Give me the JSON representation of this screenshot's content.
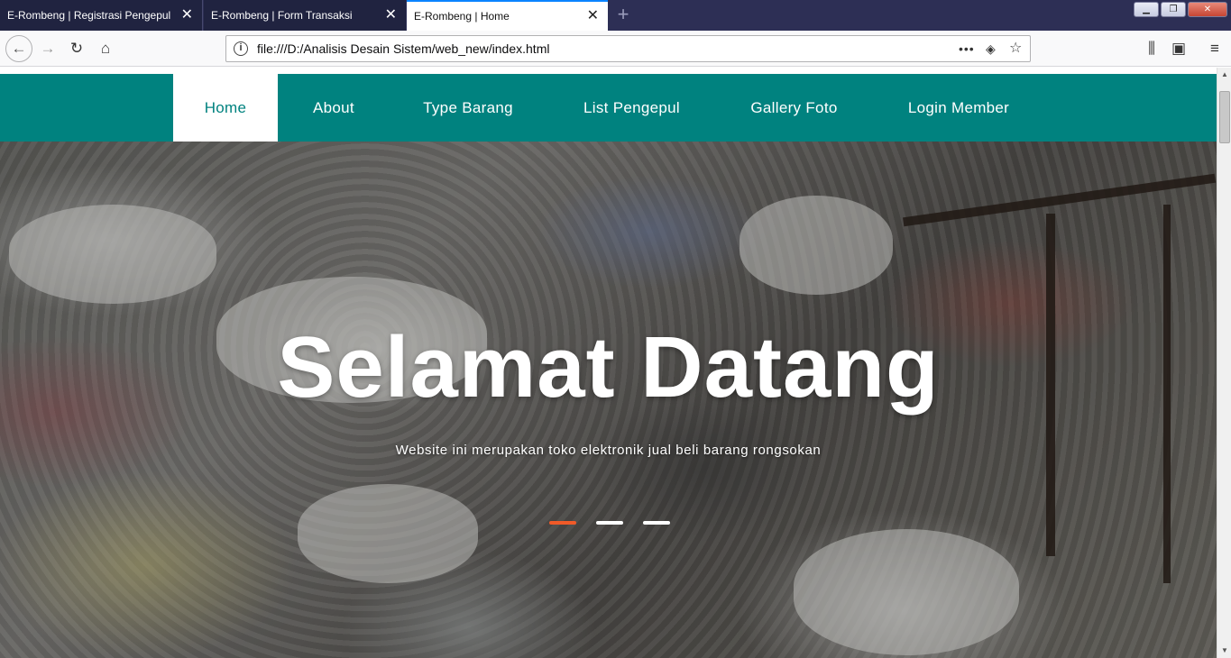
{
  "browser": {
    "tabs": [
      {
        "title": "E-Rombeng | Registrasi Pengepul",
        "active": false
      },
      {
        "title": "E-Rombeng | Form Transaksi",
        "active": false
      },
      {
        "title": "E-Rombeng | Home",
        "active": true
      }
    ],
    "new_tab_icon": "plus-icon",
    "url": "file:///D:/Analisis Desain Sistem/web_new/index.html",
    "accent_color": "#0a84ff"
  },
  "site": {
    "brand_color": "#00827f",
    "nav": [
      {
        "label": "Home",
        "active": true
      },
      {
        "label": "About",
        "active": false
      },
      {
        "label": "Type Barang",
        "active": false
      },
      {
        "label": "List Pengepul",
        "active": false
      },
      {
        "label": "Gallery Foto",
        "active": false
      },
      {
        "label": "Login Member",
        "active": false
      }
    ],
    "hero": {
      "title": "Selamat Datang",
      "subtitle": "Website ini merupakan toko elektronik jual beli barang rongsokan",
      "slides_total": 3,
      "slide_active": 1,
      "indicator_active_color": "#f05a28"
    }
  }
}
